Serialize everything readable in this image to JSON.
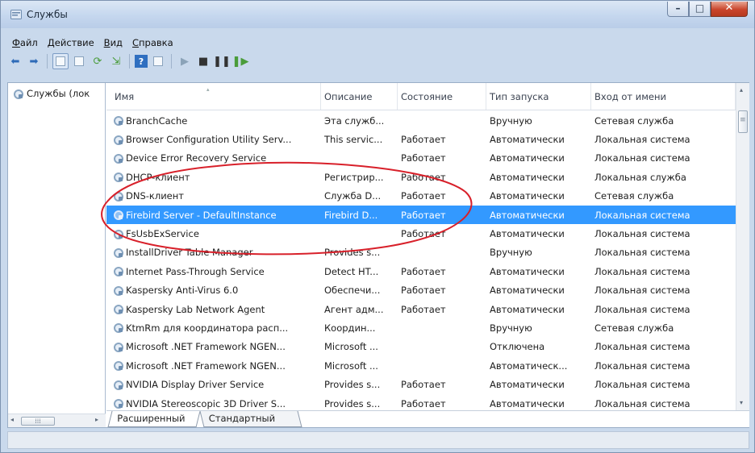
{
  "window": {
    "title": "Службы"
  },
  "menu": [
    {
      "underline": "Ф",
      "rest": "айл"
    },
    {
      "underline": "Д",
      "rest": "ействие"
    },
    {
      "underline": "В",
      "rest": "ид"
    },
    {
      "underline": "С",
      "rest": "правка"
    }
  ],
  "tree": {
    "root_label": "Службы (лок"
  },
  "columns": [
    "Имя",
    "Описание",
    "Состояние",
    "Тип запуска",
    "Вход от имени"
  ],
  "services": [
    {
      "name": "BranchCache",
      "description": "Эта служб...",
      "status": "",
      "startup": "Вручную",
      "logon": "Сетевая служба"
    },
    {
      "name": "Browser Configuration Utility Serv...",
      "description": "This servic...",
      "status": "Работает",
      "startup": "Автоматически",
      "logon": "Локальная система"
    },
    {
      "name": "Device Error Recovery Service",
      "description": "",
      "status": "Работает",
      "startup": "Автоматически",
      "logon": "Локальная система"
    },
    {
      "name": "DHCP-клиент",
      "description": "Регистрир...",
      "status": "Работает",
      "startup": "Автоматически",
      "logon": "Локальная служба"
    },
    {
      "name": "DNS-клиент",
      "description": "Служба D...",
      "status": "Работает",
      "startup": "Автоматически",
      "logon": "Сетевая служба"
    },
    {
      "name": "Firebird Server - DefaultInstance",
      "description": "Firebird D...",
      "status": "Работает",
      "startup": "Автоматически",
      "logon": "Локальная система",
      "selected": true
    },
    {
      "name": "FsUsbExService",
      "description": "",
      "status": "Работает",
      "startup": "Автоматически",
      "logon": "Локальная система"
    },
    {
      "name": "InstallDriver Table Manager",
      "description": "Provides s...",
      "status": "",
      "startup": "Вручную",
      "logon": "Локальная система"
    },
    {
      "name": "Internet Pass-Through Service",
      "description": "Detect HT...",
      "status": "Работает",
      "startup": "Автоматически",
      "logon": "Локальная система"
    },
    {
      "name": "Kaspersky Anti-Virus 6.0",
      "description": "Обеспечи...",
      "status": "Работает",
      "startup": "Автоматически",
      "logon": "Локальная система"
    },
    {
      "name": "Kaspersky Lab Network Agent",
      "description": "Агент адм...",
      "status": "Работает",
      "startup": "Автоматически",
      "logon": "Локальная система"
    },
    {
      "name": "KtmRm для координатора расп...",
      "description": "Координ...",
      "status": "",
      "startup": "Вручную",
      "logon": "Сетевая служба"
    },
    {
      "name": "Microsoft .NET Framework NGEN...",
      "description": "Microsoft ...",
      "status": "",
      "startup": "Отключена",
      "logon": "Локальная система"
    },
    {
      "name": "Microsoft .NET Framework NGEN...",
      "description": "Microsoft ...",
      "status": "",
      "startup": "Автоматическ...",
      "logon": "Локальная система"
    },
    {
      "name": "NVIDIA Display Driver Service",
      "description": "Provides s...",
      "status": "Работает",
      "startup": "Автоматически",
      "logon": "Локальная система"
    },
    {
      "name": "NVIDIA Stereoscopic 3D Driver S...",
      "description": "Provides s...",
      "status": "Работает",
      "startup": "Автоматически",
      "logon": "Локальная система"
    }
  ],
  "tabs": [
    {
      "label": "Расширенный",
      "active": true
    },
    {
      "label": "Стандартный",
      "active": false
    }
  ],
  "colors": {
    "selection": "#3399ff",
    "annotation": "#d8202a"
  },
  "icons": [
    "services-icon",
    "back-arrow-icon",
    "forward-arrow-icon",
    "show-hide-tree-icon",
    "refresh-icon",
    "export-list-icon",
    "help-icon",
    "properties-icon",
    "start-icon",
    "stop-icon",
    "pause-icon",
    "restart-icon",
    "service-gear-icon"
  ]
}
